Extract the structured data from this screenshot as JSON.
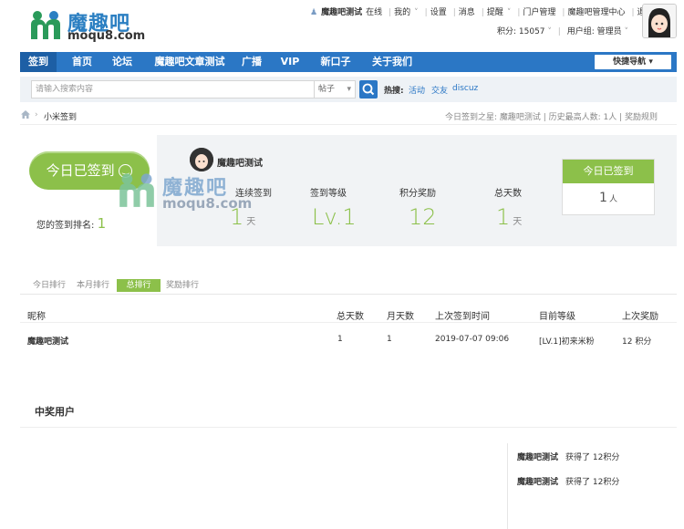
{
  "header": {
    "logo_title": "魔趣吧",
    "logo_domain": "moqu8.com",
    "topbar": {
      "user": "魔趣吧测试",
      "status": "在线",
      "links": [
        "我的",
        "设置",
        "消息",
        "提醒",
        "门户管理",
        "魔趣吧管理中心",
        "退出"
      ]
    },
    "points": "积分: 15057",
    "usergroup": "用户组: 管理员"
  },
  "nav": {
    "items": [
      "签到",
      "首页",
      "论坛",
      "魔趣吧文章测试",
      "广播",
      "VIP",
      "新口子",
      "关于我们"
    ],
    "quick_nav": "快捷导航"
  },
  "search": {
    "placeholder": "请输入搜索内容",
    "type": "帖子",
    "hot_label": "热搜:",
    "hot_terms": [
      "活动",
      "交友",
      "discuz"
    ]
  },
  "breadcrumb": {
    "current": "小米签到",
    "stats": "今日签到之星: 魔趣吧测试 | 历史最高人数: 1人 | 奖励规则"
  },
  "sign_panel": {
    "button": "今日已签到",
    "rank_label": "您的签到排名:",
    "rank_value": "1",
    "username": "魔趣吧测试",
    "stats": [
      {
        "label": "连续签到",
        "value": "1",
        "unit": "天"
      },
      {
        "label": "签到等级",
        "value": "Lv.1",
        "unit": ""
      },
      {
        "label": "积分奖励",
        "value": "12",
        "unit": ""
      },
      {
        "label": "总天数",
        "value": "1",
        "unit": "天"
      }
    ],
    "today_box": {
      "title": "今日已签到",
      "count": "1",
      "unit": "人"
    }
  },
  "rank_tabs": [
    "今日排行",
    "本月排行",
    "总排行",
    "奖励排行"
  ],
  "table": {
    "headers": [
      "昵称",
      "总天数",
      "月天数",
      "上次签到时间",
      "目前等级",
      "上次奖励"
    ],
    "rows": [
      [
        "魔趣吧测试",
        "1",
        "1",
        "2019-07-07 09:06",
        "[LV.1]初来米粉",
        "12 积分"
      ]
    ]
  },
  "winners": {
    "title": "中奖用户",
    "items": [
      {
        "name": "魔趣吧测试",
        "text": "获得了 12积分"
      },
      {
        "name": "魔趣吧测试",
        "text": "获得了 12积分"
      }
    ]
  },
  "watermark": {
    "title": "魔趣吧",
    "domain": "moqu8.com"
  },
  "colors": {
    "nav": "#2b77c5",
    "accent_green": "#8cc04a"
  }
}
